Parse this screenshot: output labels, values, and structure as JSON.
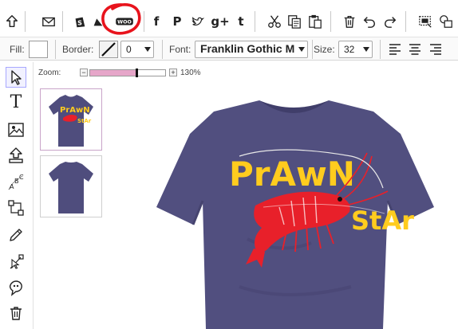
{
  "toolbar": {
    "icons": [
      "share-icon",
      "email-icon",
      "shopify-icon",
      "bag-icon",
      "woocommerce-icon",
      "facebook-icon",
      "pinterest-icon",
      "twitter-icon",
      "google-plus-icon",
      "tumblr-icon",
      "cut-icon",
      "copy-icon",
      "paste-icon",
      "trash-icon",
      "undo-icon",
      "redo-icon",
      "select-area-icon",
      "shapes-icon"
    ],
    "social_glyphs": {
      "facebook": "f",
      "pinterest": "P",
      "google_plus": "g+",
      "tumblr": "t"
    },
    "annotation_color": "#e8131c"
  },
  "format_bar": {
    "fill_label": "Fill:",
    "border_label": "Border:",
    "border_width": "0",
    "font_label": "Font:",
    "font_value": "Franklin Gothic M",
    "size_label": "Size:",
    "size_value": "32"
  },
  "tools": [
    "pointer-tool",
    "text-tool",
    "image-tool",
    "upload-tool",
    "curved-text-tool",
    "shape-tool",
    "pen-tool",
    "node-edit-tool",
    "clipart-tool",
    "delete-tool"
  ],
  "tool_glyphs": {
    "text": "T"
  },
  "zoom": {
    "label": "Zoom:",
    "minus": "−",
    "plus": "+",
    "value": "130%",
    "level": 0.62
  },
  "views": [
    {
      "name": "front"
    },
    {
      "name": "back"
    }
  ],
  "design": {
    "line1": "PrAwN",
    "line2": "StAr",
    "shirt_color": "#514f7f",
    "text_color": "#ffcc1e",
    "shrimp_color": "#e8202a"
  }
}
